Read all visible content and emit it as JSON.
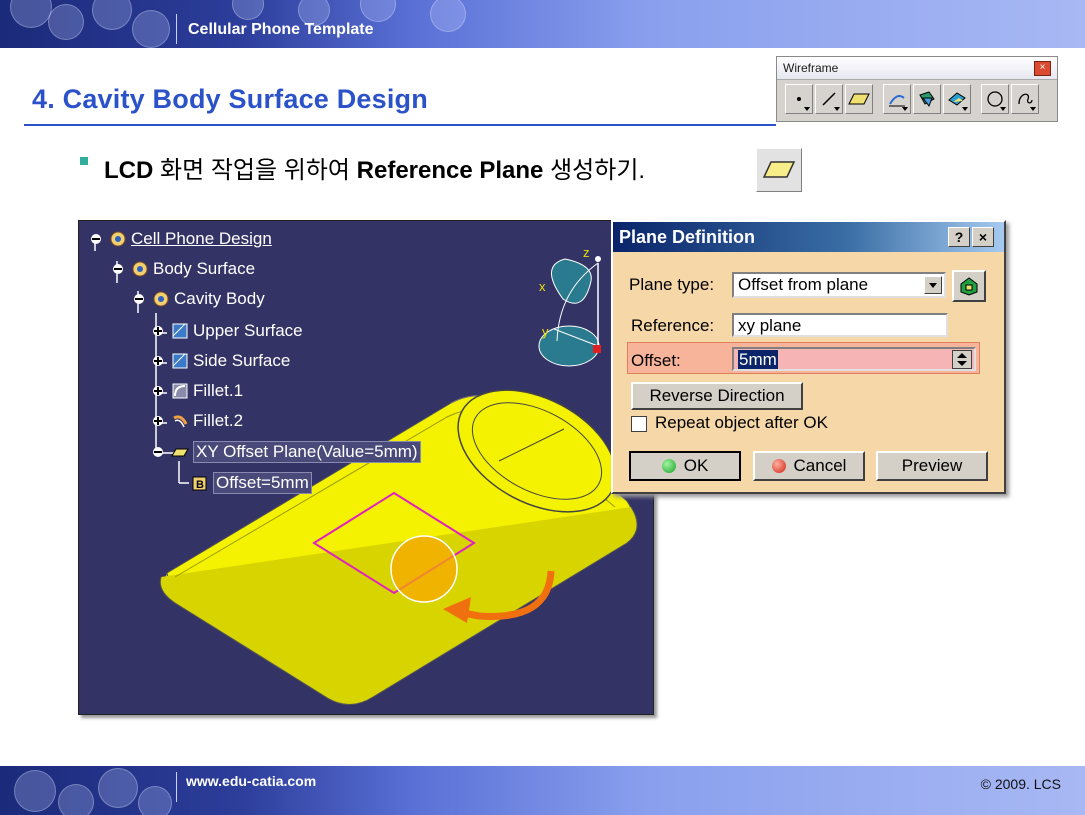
{
  "header": {
    "title": "Cellular Phone Template"
  },
  "page": {
    "heading": "4. Cavity Body Surface Design"
  },
  "toolbar": {
    "title": "Wireframe",
    "close_glyph": "×",
    "buttons": [
      {
        "icon": "point-icon"
      },
      {
        "icon": "line-icon"
      },
      {
        "icon": "plane-icon"
      },
      {
        "icon": "projection-icon"
      },
      {
        "icon": "intersection-icon"
      },
      {
        "icon": "offset-surface-icon"
      },
      {
        "icon": "circle-icon"
      },
      {
        "icon": "spline-icon"
      }
    ]
  },
  "bullet": {
    "part1": "LCD",
    "part2": " 화면 작업을 위하여 ",
    "part3": "Reference Plane",
    "part4": " 생성하기."
  },
  "tree": {
    "items": [
      {
        "label": "Cell Phone Design",
        "icon": "product-icon"
      },
      {
        "label": "Body Surface",
        "icon": "part-icon"
      },
      {
        "label": "Cavity Body",
        "icon": "body-icon"
      },
      {
        "label": "Upper Surface",
        "icon": "surface-icon"
      },
      {
        "label": "Side Surface",
        "icon": "surface-icon"
      },
      {
        "label": "Fillet.1",
        "icon": "fillet-icon"
      },
      {
        "label": "Fillet.2",
        "icon": "fillet-icon"
      },
      {
        "label": "XY Offset Plane(Value=5mm)",
        "icon": "plane-icon"
      },
      {
        "label": "Offset=5mm",
        "icon": "parameter-icon"
      }
    ]
  },
  "compass": {
    "z": "z",
    "x": "x",
    "y": "y"
  },
  "dialog": {
    "title": "Plane Definition",
    "help": "?",
    "close": "×",
    "plane_type_label": "Plane type:",
    "plane_type_value": "Offset from plane",
    "reference_label": "Reference:",
    "reference_value": "xy plane",
    "offset_label": "Offset:",
    "offset_value": "5mm",
    "reverse_label": "Reverse Direction",
    "repeat_label": "Repeat object after OK",
    "ok_label": "OK",
    "cancel_label": "Cancel",
    "preview_label": "Preview"
  },
  "footer": {
    "url": "www.edu-catia.com",
    "copyright": "© 2009. LCS"
  }
}
